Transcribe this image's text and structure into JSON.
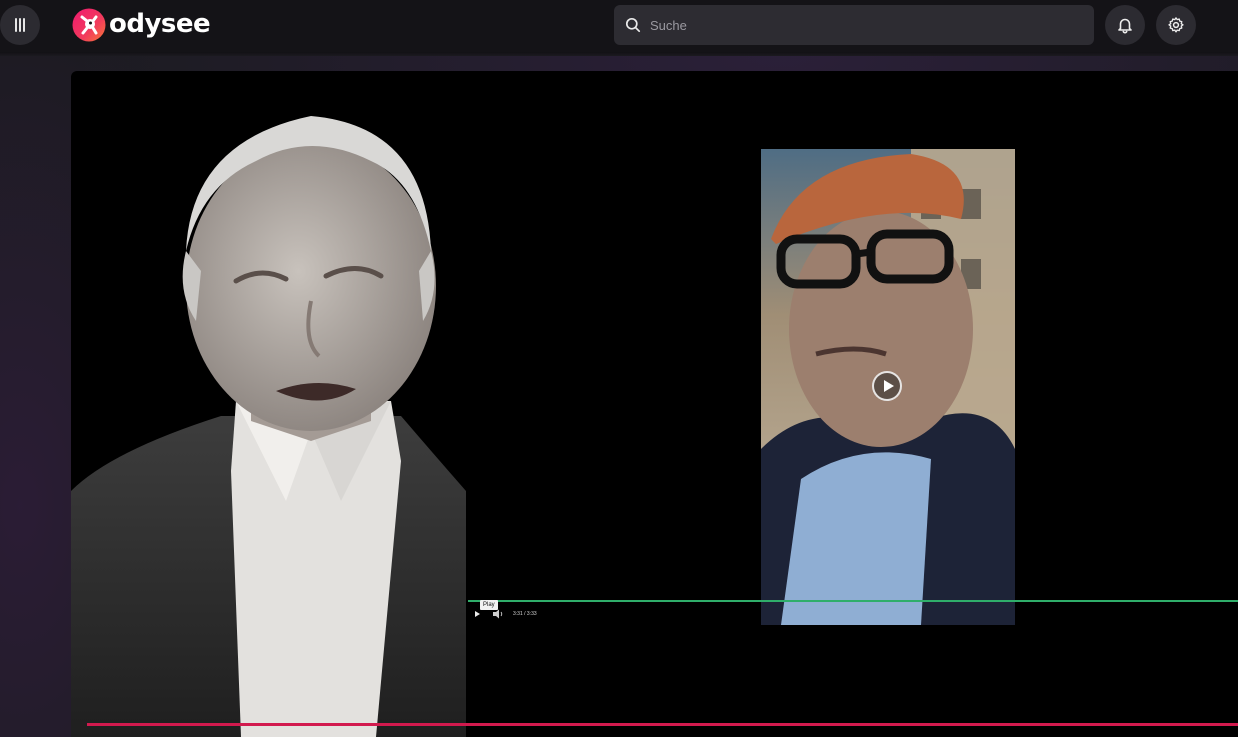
{
  "header": {
    "logo_text": "odysee",
    "search": {
      "placeholder": "Suche",
      "value": ""
    },
    "icons": {
      "menu": "menu-bars-icon",
      "search": "search-icon",
      "notifications": "bell-icon",
      "settings": "gear-icon"
    }
  },
  "player": {
    "inner_video": {
      "tooltip": "Play",
      "time": "3:31  /  3:33",
      "progress_fraction": 0.99
    },
    "progress_fraction": 1.0
  },
  "colors": {
    "brand_accent": "#e50054",
    "progress_red": "#d21a4e",
    "inner_progress_green": "#2fae6a",
    "header_bg": "#141317"
  }
}
